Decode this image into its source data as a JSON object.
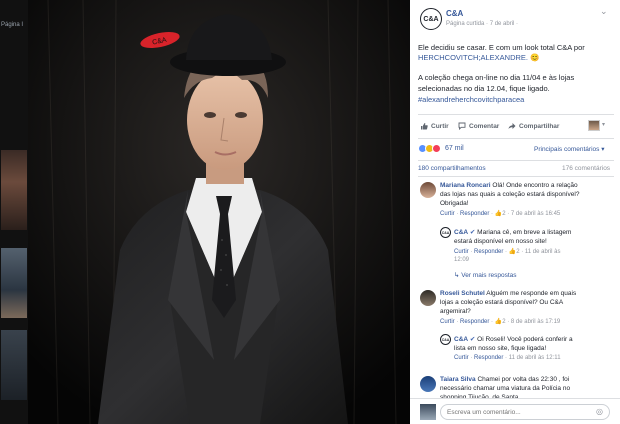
{
  "left_strip": {
    "label": "Página I"
  },
  "post": {
    "page_name": "C&A",
    "logo_text": "C&A",
    "subtitle": "Página curtida · 7 de abril ·",
    "text_line1": "Ele decidiu se casar. E com um look total C&A por",
    "text_line2": "HERCHCOVITCH;ALEXANDRE. 😊",
    "text_line3": "A coleção chega on-line no dia 11/04 e às lojas",
    "text_line4": "selecionadas no dia 12.04, fique ligado.",
    "hashtag": "#alexandreherchcovitchparacea",
    "actions": {
      "like": "Curtir",
      "comment": "Comentar",
      "share": "Compartilhar"
    },
    "reactions_count": "67 mil",
    "sort_label": "Principais comentários ▾",
    "shares": "180 compartilhamentos",
    "comments_count": "176 comentários"
  },
  "comments": [
    {
      "author": "Mariana Roncari",
      "text1": "Olá! Onde encontro a relação",
      "text2": "das lojas nas quais a coleção estará disponível?",
      "text3": "Obrigada!",
      "meta_like": "Curtir",
      "meta_reply": "Responder",
      "meta_count": "2",
      "meta_date": "7 de abril às 16:45"
    },
    {
      "author": "C&A",
      "text1": "Mariana cê, em breve a listagem",
      "text2": "estará disponível em nosso site!",
      "meta_like": "Curtir",
      "meta_reply": "Responder",
      "meta_count": "2",
      "meta_date": "11 de abril às",
      "meta_time": "12:09"
    },
    {
      "more_replies": "Ver mais respostas"
    },
    {
      "author": "Roseli Schutel",
      "text1": "Alguém me responde em quais",
      "text2": "lojas a coleção estará disponível? Ou C&A",
      "text3": "argemiral?",
      "meta_like": "Curtir",
      "meta_reply": "Responder",
      "meta_count": "2",
      "meta_date": "8 de abril às 17:19"
    },
    {
      "author": "C&A",
      "text1": "Oi Roseli! Você poderá conferir a",
      "text2": "lista em nosso site, fique ligada!",
      "meta_like": "Curtir",
      "meta_reply": "Responder",
      "meta_date": "11 de abril às 12:11"
    },
    {
      "author": "Taiara Silva",
      "text1": "Chamei por volta das 22:30 , foi",
      "text2": "necessário chamar uma viatura da Polícia no",
      "text3": "shopping Tijucão, de Santa..."
    }
  ],
  "composer": {
    "placeholder": "Escreva um comentário..."
  },
  "colors": {
    "link": "#365899",
    "muted": "#90949c",
    "text": "#1d2129",
    "cap_red": "#d8232a"
  }
}
